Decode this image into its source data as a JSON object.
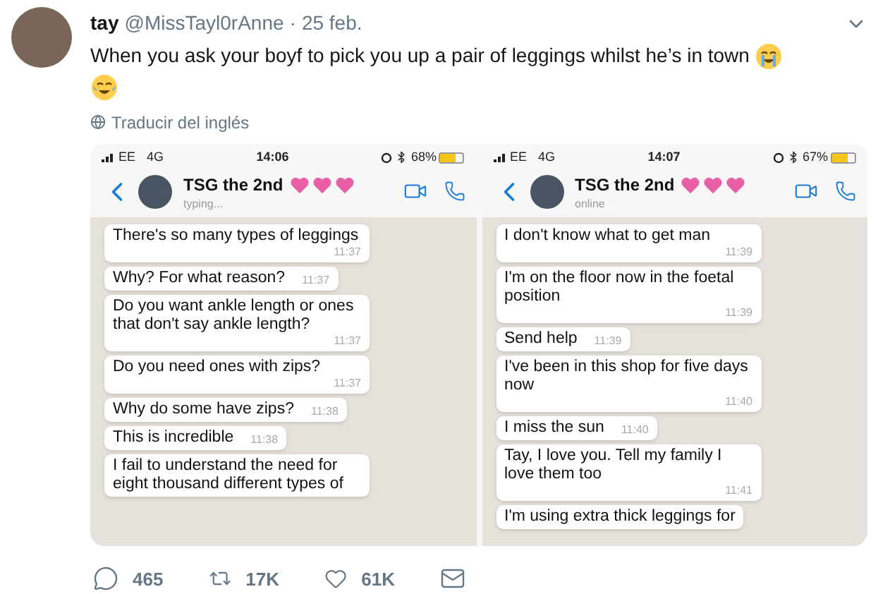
{
  "tweet": {
    "name": "tay",
    "handle": "@MissTayl0rAnne",
    "separator": "·",
    "date": "25 feb.",
    "text": "When you ask your boyf to pick you up a pair of leggings whilst he’s in town",
    "translate": "Traducir del inglés"
  },
  "screenshots": [
    {
      "status": {
        "carrier": "EE",
        "network": "4G",
        "time": "14:06",
        "battery": "68%",
        "level": 0.68
      },
      "chat": {
        "name": "TSG the 2nd",
        "presence": "typing..."
      },
      "messages": [
        {
          "text": "There's so many types of leggings",
          "time": "11:37"
        },
        {
          "text": "Why? For what reason?",
          "time": "11:37"
        },
        {
          "text": "Do you want ankle length or ones that don't say ankle length?",
          "time": "11:37"
        },
        {
          "text": "Do you need ones with zips?",
          "time": "11:37"
        },
        {
          "text": "Why do some have zips?",
          "time": "11:38"
        },
        {
          "text": "This is incredible",
          "time": "11:38"
        },
        {
          "text": "I fail to understand the need for eight thousand different types of"
        }
      ]
    },
    {
      "status": {
        "carrier": "EE",
        "network": "4G",
        "time": "14:07",
        "battery": "67%",
        "level": 0.67
      },
      "chat": {
        "name": "TSG the 2nd",
        "presence": "online"
      },
      "messages": [
        {
          "text": "I don't know what to get man",
          "time": "11:39"
        },
        {
          "text": "I'm on the floor now in the foetal position",
          "time": "11:39"
        },
        {
          "text": "Send help",
          "time": "11:39"
        },
        {
          "text": "I've been in this shop for five days now",
          "time": "11:40"
        },
        {
          "text": "I miss the sun",
          "time": "11:40"
        },
        {
          "text": "Tay, I love you. Tell my family I love them too",
          "time": "11:41"
        },
        {
          "text": "I'm using extra thick leggings for"
        }
      ]
    }
  ],
  "actions": [
    {
      "kind": "reply",
      "count": "465"
    },
    {
      "kind": "retweet",
      "count": "17K"
    },
    {
      "kind": "like",
      "count": "61K"
    },
    {
      "kind": "message"
    }
  ]
}
